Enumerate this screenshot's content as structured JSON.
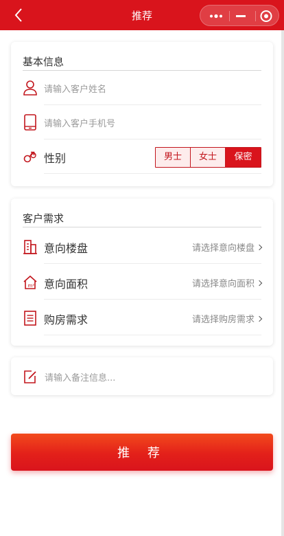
{
  "header": {
    "title": "推荐"
  },
  "basic_info": {
    "title": "基本信息",
    "name_placeholder": "请输入客户姓名",
    "phone_placeholder": "请输入客户手机号",
    "gender_label": "性别",
    "gender_options": [
      "男士",
      "女士",
      "保密"
    ],
    "gender_selected": "保密"
  },
  "demand": {
    "title": "客户需求",
    "items": [
      {
        "label": "意向楼盘",
        "value": "请选择意向楼盘",
        "icon": "building-icon"
      },
      {
        "label": "意向面积",
        "value": "请选择意向面积",
        "icon": "house-area-icon"
      },
      {
        "label": "购房需求",
        "value": "请选择购房需求",
        "icon": "list-icon"
      }
    ]
  },
  "remark": {
    "placeholder": "请输入备注信息..."
  },
  "submit_label": "推 荐",
  "colors": {
    "brand": "#d9141c",
    "icon": "#c2151c"
  }
}
